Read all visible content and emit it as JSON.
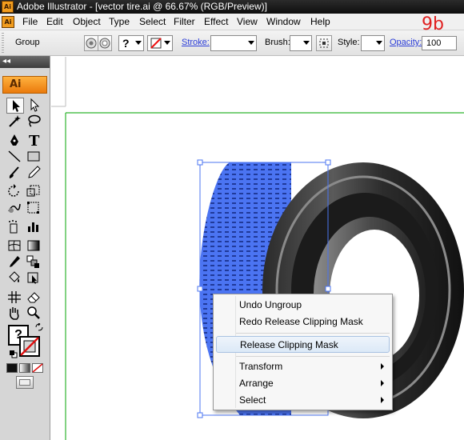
{
  "window": {
    "title": "Adobe Illustrator - [vector tire.ai @ 66.67% (RGB/Preview)]",
    "app_badge": "Ai"
  },
  "menubar": {
    "items": [
      "File",
      "Edit",
      "Object",
      "Type",
      "Select",
      "Filter",
      "Effect",
      "View",
      "Window",
      "Help"
    ]
  },
  "controlbar": {
    "selection_label": "Group",
    "help_glyph": "?",
    "stroke_label": "Stroke:",
    "brush_label": "Brush:",
    "style_label": "Style:",
    "opacity_label": "Opacity:",
    "opacity_value": "100"
  },
  "annotation": {
    "step": "9b",
    "color": "#e02020"
  },
  "tools_panel": {
    "logo": "Ai",
    "collapse_glyph": "◂◂",
    "fill_stroke_glyph": "?"
  },
  "context_menu": {
    "items": [
      {
        "label": "Undo Ungroup",
        "submenu": false
      },
      {
        "label": "Redo Release Clipping Mask",
        "submenu": false
      },
      {
        "label": "Release Clipping Mask",
        "submenu": false,
        "highlighted": true
      },
      {
        "label": "Transform",
        "submenu": true
      },
      {
        "label": "Arrange",
        "submenu": true
      },
      {
        "label": "Select",
        "submenu": true
      }
    ]
  },
  "colors": {
    "selection_blue": "#4b74f2",
    "artboard_green": "#2fb52f",
    "menu_highlight": "#dce9f7",
    "link_text": "#2a3cd8"
  },
  "icons": [
    "collapse-icon",
    "selection-tool-icon",
    "direct-selection-tool-icon",
    "magic-wand-icon",
    "lasso-icon",
    "pen-icon",
    "type-icon",
    "line-segment-icon",
    "rectangle-icon",
    "paintbrush-icon",
    "pencil-icon",
    "rotate-icon",
    "scale-icon",
    "warp-icon",
    "free-transform-icon",
    "symbol-sprayer-icon",
    "column-graph-icon",
    "mesh-icon",
    "gradient-icon",
    "eyedropper-icon",
    "blend-icon",
    "live-paint-bucket-icon",
    "live-paint-selection-icon",
    "slice-icon",
    "eraser-icon",
    "hand-icon",
    "zoom-icon",
    "fill-stroke-swatch-icon",
    "swap-icon",
    "default-colors-icon",
    "color-mode-icon",
    "gradient-mode-icon",
    "none-mode-icon",
    "screen-mode-icon"
  ]
}
